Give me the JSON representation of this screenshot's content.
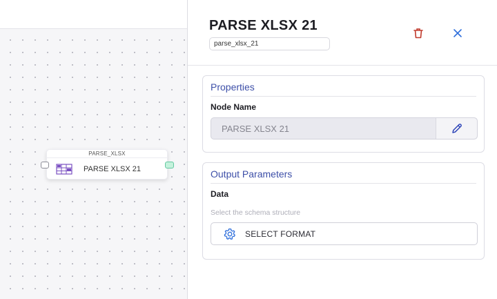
{
  "canvas": {
    "node": {
      "header": "PARSE_XLSX",
      "label": "PARSE XLSX 21",
      "icon": "spreadsheet-icon"
    }
  },
  "panel": {
    "title": "PARSE XLSX 21",
    "node_id": "parse_xlsx_21",
    "icons": {
      "delete": "trash-icon",
      "close": "close-icon"
    },
    "properties": {
      "section_title": "Properties",
      "node_name_label": "Node Name",
      "node_name_value": "PARSE XLSX 21",
      "edit_icon": "pencil-icon"
    },
    "output": {
      "section_title": "Output Parameters",
      "data_label": "Data",
      "helper_text": "Select the schema structure",
      "select_button_label": "SELECT FORMAT",
      "select_icon": "gear-icon"
    }
  },
  "colors": {
    "accent": "#3d4fa8",
    "delete": "#c0392b",
    "close": "#2f6fdc",
    "handle_out": "#63c7a0",
    "node_icon": "#7a4fc2"
  }
}
